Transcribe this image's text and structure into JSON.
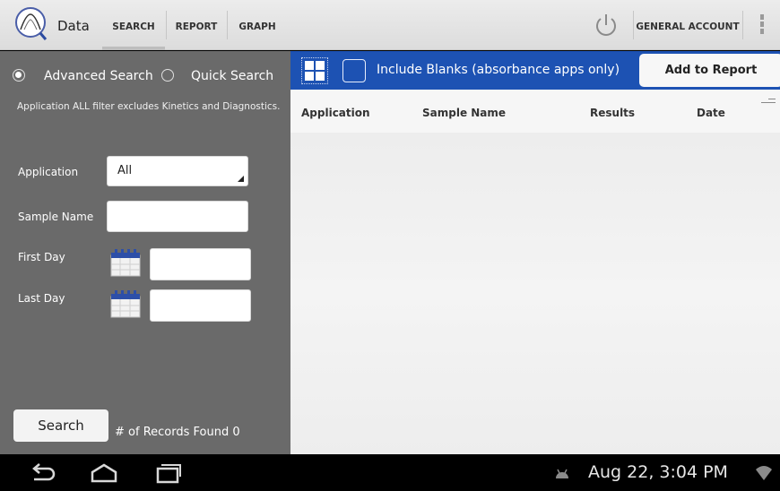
{
  "header": {
    "app_title": "Data",
    "tabs": [
      {
        "label": "SEARCH",
        "selected": true
      },
      {
        "label": "REPORT",
        "selected": false
      },
      {
        "label": "GRAPH",
        "selected": false
      }
    ],
    "account_label": "GENERAL ACCOUNT"
  },
  "search_panel": {
    "mode_options": [
      {
        "label": "Advanced Search",
        "selected": true
      },
      {
        "label": "Quick Search",
        "selected": false
      }
    ],
    "note": "Application ALL filter excludes Kinetics and Diagnostics.",
    "application": {
      "label": "Application",
      "value": "All"
    },
    "sample_name": {
      "label": "Sample Name",
      "value": ""
    },
    "first_day": {
      "label": "First Day",
      "value": ""
    },
    "last_day": {
      "label": "Last Day",
      "value": ""
    },
    "search_button": "Search",
    "records_label": "# of Records Found",
    "records_count": "0"
  },
  "results_panel": {
    "include_blanks_label": "Include Blanks (absorbance apps only)",
    "include_blanks_checked": false,
    "add_to_report_button": "Add to Report",
    "columns": [
      "Application",
      "Sample Name",
      "Results",
      "Date"
    ],
    "rows": []
  },
  "system_bar": {
    "clock": "Aug 22, 3:04 PM"
  },
  "colors": {
    "accent_blue": "#1d52b3",
    "left_panel": "#6a6a6a",
    "action_bar": "#e4e4e4"
  }
}
